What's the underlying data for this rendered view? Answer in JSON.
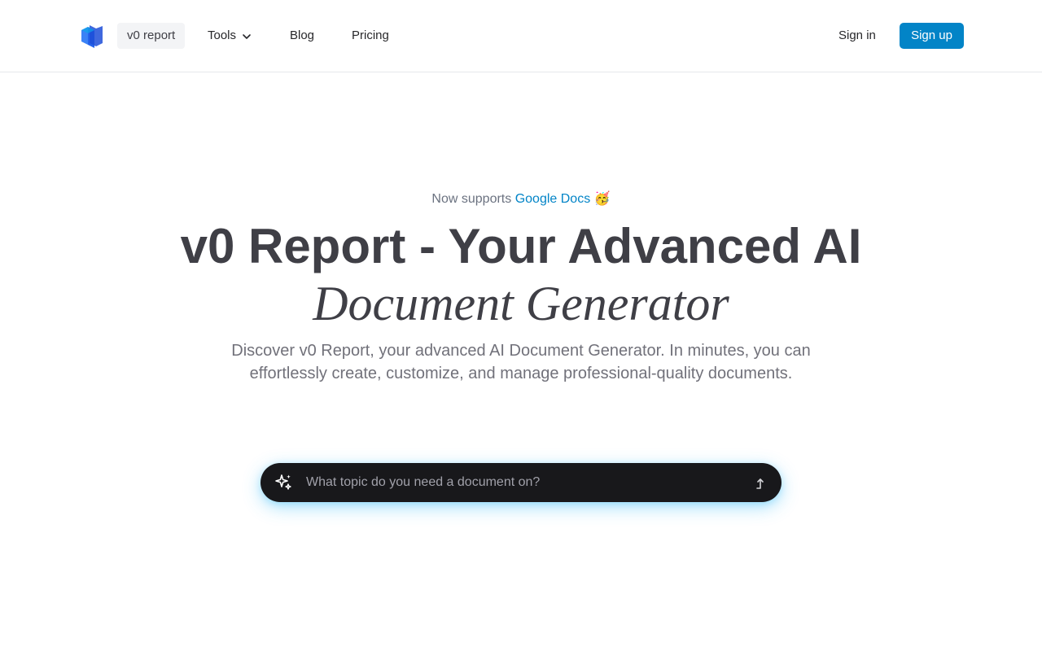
{
  "header": {
    "logo_icon": "cube-logo-icon",
    "nav": {
      "home_label": "v0 report",
      "tools_label": "Tools",
      "blog_label": "Blog",
      "pricing_label": "Pricing"
    },
    "sign_in_label": "Sign in",
    "sign_up_label": "Sign up"
  },
  "hero": {
    "announcement_prefix": "Now supports",
    "announcement_link": "Google Docs",
    "announcement_emoji": "🥳",
    "title_line1": "v0 Report - Your Advanced AI",
    "title_line2": "Document Generator",
    "description": "Discover v0 Report, your advanced AI Document Generator. In minutes, you can effortlessly create, customize, and manage professional-quality documents."
  },
  "prompt": {
    "placeholder": "What topic do you need a document on?",
    "value": "",
    "left_icon": "sparkles-icon",
    "submit_icon": "arrow-up-icon"
  },
  "colors": {
    "accent": "#0284c7",
    "prompt_bg": "#18181b",
    "glow": "#38bdf8"
  }
}
